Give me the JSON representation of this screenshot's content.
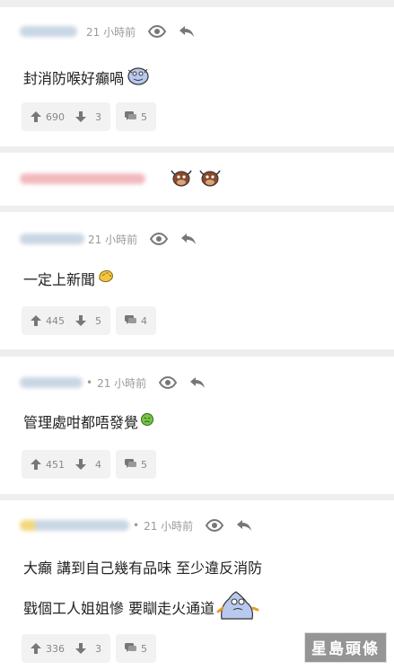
{
  "comments": [
    {
      "time": "21 小時前",
      "text": "封消防喉好癲喎",
      "upvotes": "690",
      "downvotes": "3",
      "replies": "5"
    },
    {
      "time": "",
      "text": "",
      "upvotes": "",
      "downvotes": "",
      "replies": ""
    },
    {
      "time": "21 小時前",
      "text": "一定上新聞",
      "upvotes": "445",
      "downvotes": "5",
      "replies": "4"
    },
    {
      "time": "21 小時前",
      "text": "管理處咁都唔發覺",
      "upvotes": "451",
      "downvotes": "4",
      "replies": "5"
    },
    {
      "time": "21 小時前",
      "text_line1": "大癲 講到自己幾有品味 至少違反消防",
      "text_line2": "戥個工人姐姐慘 要瞓走火通道",
      "upvotes": "336",
      "downvotes": "3",
      "replies": "5"
    }
  ],
  "separator_dot": "•",
  "watermark": "星島頭條",
  "icons": [
    "eye-icon",
    "reply-icon",
    "thumbs-up-icon",
    "thumbs-down-icon",
    "comment-icon",
    "blob-emoji-icon",
    "bull-emoji-icon",
    "hand-wave-emoji-icon",
    "angry-face-emoji-icon",
    "flame-emoji-icon"
  ]
}
